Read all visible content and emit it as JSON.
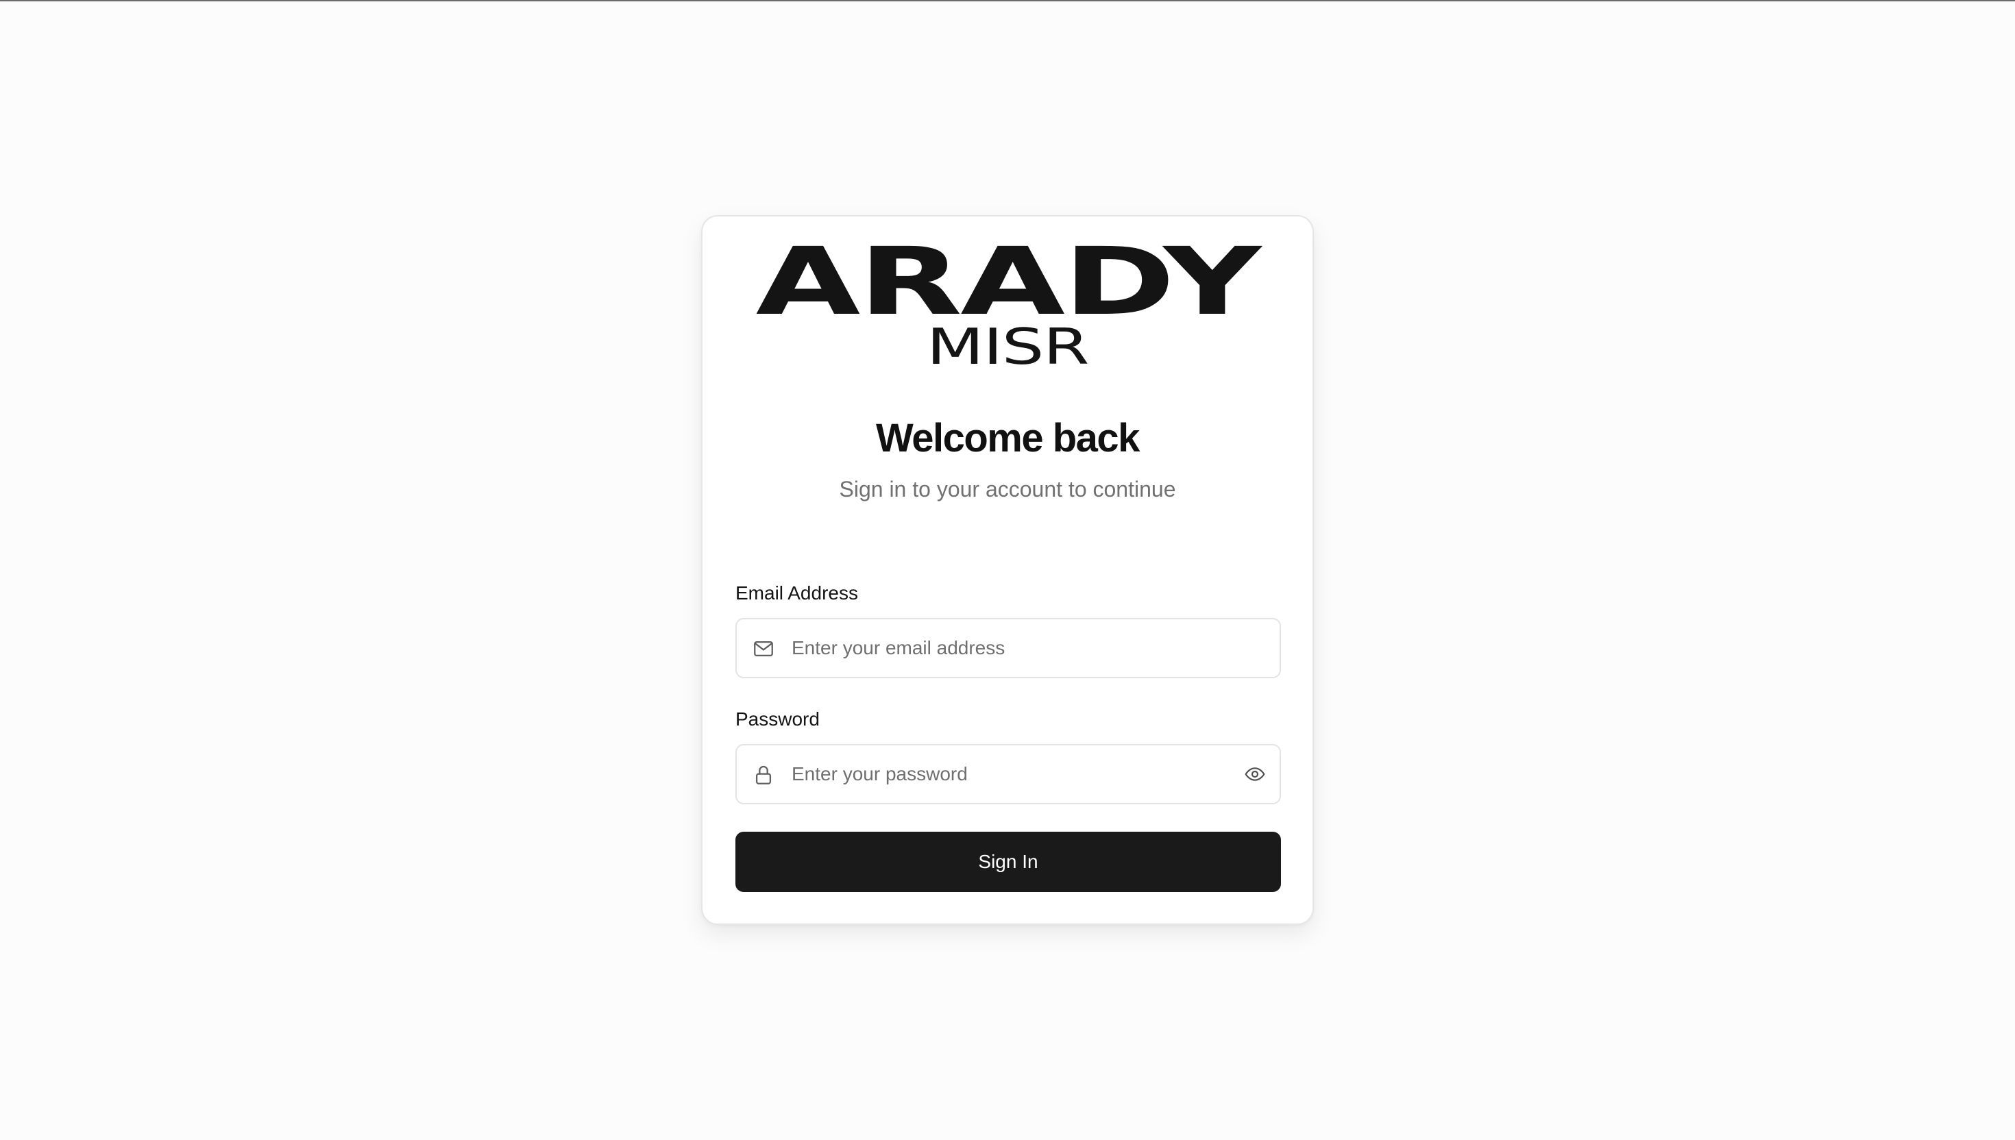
{
  "brand": {
    "logo_main": "ARADY",
    "logo_sub": "MISR"
  },
  "heading": {
    "title": "Welcome back",
    "subtitle": "Sign in to your account to continue"
  },
  "form": {
    "email": {
      "label": "Email Address",
      "placeholder": "Enter your email address",
      "value": "",
      "icon": "mail-icon"
    },
    "password": {
      "label": "Password",
      "placeholder": "Enter your password",
      "value": "",
      "icon": "lock-icon",
      "toggle_icon": "eye-icon"
    },
    "submit_label": "Sign In"
  },
  "colors": {
    "page_background": "#fcfcfc",
    "card_background": "#ffffff",
    "button_background": "#1a1a1a",
    "button_text": "#ffffff",
    "muted_text": "#707070"
  }
}
